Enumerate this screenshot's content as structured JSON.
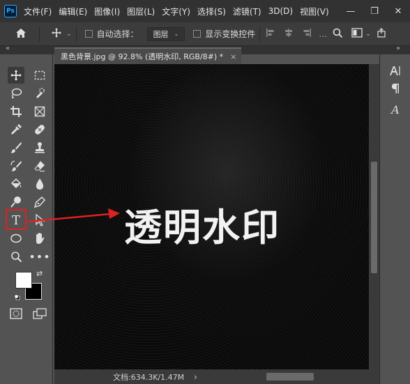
{
  "app": {
    "logo": "Ps"
  },
  "menu": [
    "文件(F)",
    "编辑(E)",
    "图像(I)",
    "图层(L)",
    "文字(Y)",
    "选择(S)",
    "滤镜(T)",
    "3D(D)",
    "视图(V)"
  ],
  "window_controls": {
    "minimize": "—",
    "restore": "❐",
    "close": "✕"
  },
  "options": {
    "auto_select_label": "自动选择：",
    "auto_select_value": "图层",
    "show_transform_label": "显示变换控件"
  },
  "collapse": {
    "left": "«",
    "right": "»"
  },
  "document_tab": {
    "title": "黑色背景.jpg @ 92.8% (透明水印, RGB/8#) *",
    "close": "×"
  },
  "canvas": {
    "text": "透明水印"
  },
  "status": {
    "doc_info": "文档:634.3K/1.47M",
    "arrow": "›"
  },
  "colors": {
    "foreground": "#ffffff",
    "background": "#000000",
    "highlight": "#e02020",
    "canvas_bg": "#0a0a0a"
  },
  "tools": [
    "move-tool",
    "marquee-tool",
    "lasso-tool",
    "quick-select-tool",
    "crop-tool",
    "frame-tool",
    "eyedropper-tool",
    "healing-tool",
    "brush-tool",
    "stamp-tool",
    "history-brush-tool",
    "eraser-tool",
    "paint-bucket-tool",
    "blur-tool",
    "dodge-tool",
    "pen-tool",
    "type-tool",
    "path-select-tool",
    "ellipse-tool",
    "hand-tool",
    "zoom-tool",
    "more-tool"
  ],
  "right_panel_icons": [
    "character-panel-icon",
    "paragraph-panel-icon",
    "glyphs-panel-icon"
  ]
}
